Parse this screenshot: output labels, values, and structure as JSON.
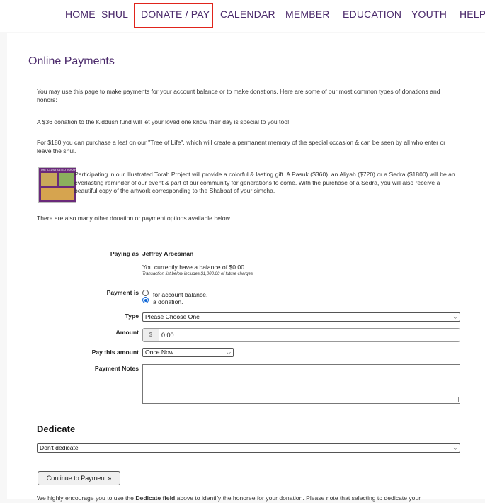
{
  "nav": {
    "items": [
      "HOME",
      "SHUL",
      "DONATE / PAY",
      "CALENDAR",
      "MEMBER",
      "EDUCATION",
      "YOUTH",
      "HELP"
    ],
    "active": "DONATE / PAY"
  },
  "page": {
    "title": "Online Payments",
    "intro": "You may use this page to make payments for your account balance or to make donations. Here are some of our most common types of donations and honors:",
    "kiddush": "A $36 donation to the Kiddush fund will let your loved one know their day is special to you too!",
    "tree": "For $180 you can purchase a leaf on our \"Tree of Life\", which will create a permanent memory of the special occasion & can be seen by all who enter or leave the shul.",
    "torah": "Participating in our Illustrated Torah Project will provide a colorful & lasting gift. A Pasuk ($360), an Aliyah ($720) or a Sedra ($1800) will be an everlasting reminder of our event & part of our community for generations to come. With the purchase of a Sedra, you will also receive a beautiful copy of the artwork corresponding to the Shabbat of your simcha.",
    "torah_thumb_text": "THE ILLUSTRATED TORAH",
    "other": "There are also many other donation or payment options available below."
  },
  "form": {
    "paying_as_label": "Paying as",
    "paying_as_name": "Jeffrey Arbesman",
    "balance": "You currently have a balance of $0.00",
    "transactions_note": "Transaction list below includes $1,000.00 of future charges.",
    "payment_is_label": "Payment is",
    "option_balance": "for account balance.",
    "option_donation": "a donation.",
    "selected_option": "a donation.",
    "type_label": "Type",
    "type_value": "Please Choose One",
    "amount_label": "Amount",
    "amount_prefix": "$",
    "amount_value": "0.00",
    "pay_label": "Pay this amount",
    "pay_value": "Once Now",
    "notes_label": "Payment Notes"
  },
  "dedicate": {
    "heading": "Dedicate",
    "value": "Don't dedicate"
  },
  "continue_button": "Continue to Payment »",
  "footer": {
    "before": "We highly encourage you to use the ",
    "bold": "Dedicate field",
    "after": " above to identify the honoree for your donation. Please note that selecting to dedicate your"
  },
  "colors": {
    "nav_text": "#4b2a6b",
    "highlight": "#e0241b",
    "radio_selected": "#0a64d6"
  }
}
